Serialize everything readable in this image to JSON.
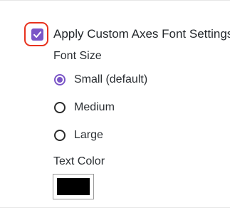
{
  "axes_font": {
    "apply_custom": {
      "label": "Apply Custom Axes Font Settings",
      "checked": true
    },
    "font_size": {
      "label": "Font Size",
      "options": [
        {
          "label": "Small (default)",
          "selected": true
        },
        {
          "label": "Medium",
          "selected": false
        },
        {
          "label": "Large",
          "selected": false
        }
      ]
    },
    "text_color": {
      "label": "Text Color",
      "value": "#000000"
    }
  },
  "colors": {
    "accent": "#7b56c7",
    "highlight": "#e8321e"
  }
}
